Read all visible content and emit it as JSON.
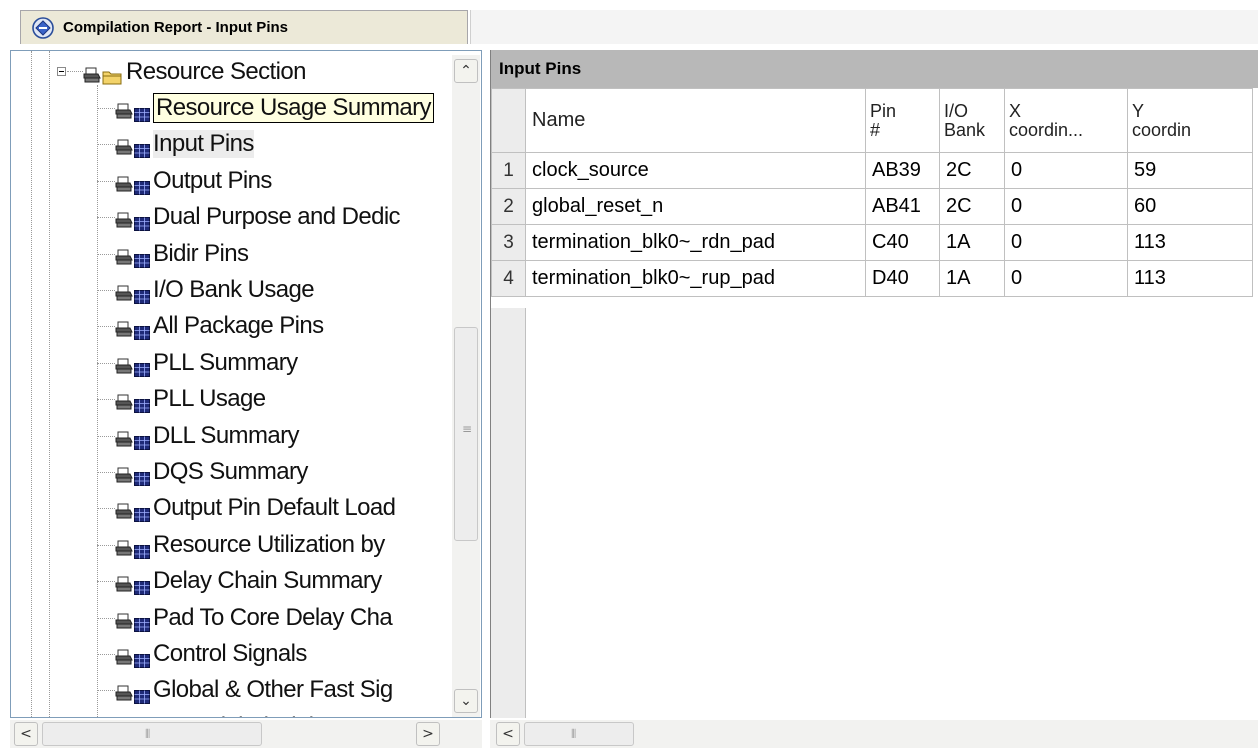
{
  "tab": {
    "title": "Compilation Report - Input Pins"
  },
  "tree": {
    "section_label": "Resource Section",
    "items": [
      {
        "label": "Resource Usage Summary"
      },
      {
        "label": "Input Pins"
      },
      {
        "label": "Output Pins"
      },
      {
        "label": "Dual Purpose and Dedic"
      },
      {
        "label": "Bidir Pins"
      },
      {
        "label": "I/O Bank Usage"
      },
      {
        "label": "All Package Pins"
      },
      {
        "label": "PLL Summary"
      },
      {
        "label": "PLL Usage"
      },
      {
        "label": "DLL Summary"
      },
      {
        "label": "DQS Summary"
      },
      {
        "label": "Output Pin Default Load"
      },
      {
        "label": "Resource Utilization by"
      },
      {
        "label": "Delay Chain Summary"
      },
      {
        "label": "Pad To Core Delay Cha"
      },
      {
        "label": "Control Signals"
      },
      {
        "label": "Global & Other Fast Sig"
      },
      {
        "label": "Non-Global High Fan-O"
      }
    ],
    "selected_item": "Input Pins",
    "tooltip_item": "Resource Usage Summary"
  },
  "report": {
    "title": "Input Pins",
    "columns": [
      {
        "line1": "Name",
        "line2": ""
      },
      {
        "line1": "Pin",
        "line2": "#"
      },
      {
        "line1": "I/O",
        "line2": "Bank"
      },
      {
        "line1": "X",
        "line2": "coordin..."
      },
      {
        "line1": "Y",
        "line2": "coordin"
      }
    ],
    "rows": [
      {
        "num": "1",
        "name": "clock_source",
        "pin": "AB39",
        "bank": "2C",
        "x": "0",
        "y": "59"
      },
      {
        "num": "2",
        "name": "global_reset_n",
        "pin": "AB41",
        "bank": "2C",
        "x": "0",
        "y": "60"
      },
      {
        "num": "3",
        "name": "termination_blk0~_rdn_pad",
        "pin": "C40",
        "bank": "1A",
        "x": "0",
        "y": "113"
      },
      {
        "num": "4",
        "name": "termination_blk0~_rup_pad",
        "pin": "D40",
        "bank": "1A",
        "x": "0",
        "y": "113"
      }
    ]
  },
  "scrollbars": {
    "up_arrow": "⌃",
    "down_arrow": "⌄",
    "left_arrow": "<",
    "right_arrow": ">",
    "grip_vertical": "≡",
    "grip_horizontal": "⦀"
  },
  "colors": {
    "panel_header": "#b8b8b8",
    "row_number_bg": "#ececec",
    "grid_line": "#c0c0c0",
    "tooltip_bg": "#ffffe1",
    "tab_bg": "#ece9d8"
  },
  "icons": {
    "tab": "compilation-report-icon",
    "tree_item": "print-table-icon",
    "section": "print-folder-icon"
  }
}
